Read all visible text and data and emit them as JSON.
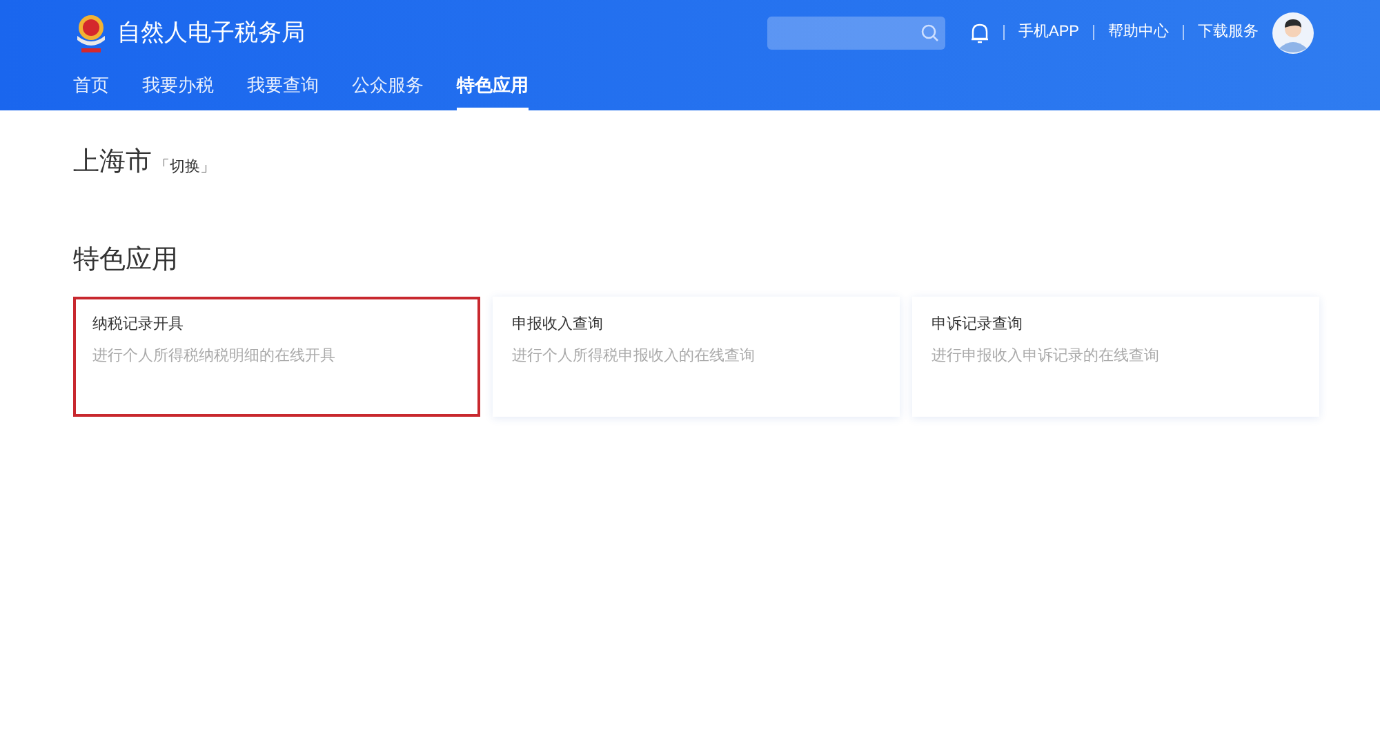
{
  "header": {
    "site_title": "自然人电子税务局",
    "links": [
      "手机APP",
      "帮助中心",
      "下载服务"
    ]
  },
  "nav": [
    {
      "label": "首页",
      "selected": false
    },
    {
      "label": "我要办税",
      "selected": false
    },
    {
      "label": "我要查询",
      "selected": false
    },
    {
      "label": "公众服务",
      "selected": false
    },
    {
      "label": "特色应用",
      "selected": true
    }
  ],
  "region": {
    "city": "上海市",
    "switch": "「切换」"
  },
  "section_title": "特色应用",
  "cards": [
    {
      "title": "纳税记录开具",
      "description": "进行个人所得税纳税明细的在线开具",
      "highlighted": true
    },
    {
      "title": "申报收入查询",
      "description": "进行个人所得税申报收入的在线查询",
      "highlighted": false
    },
    {
      "title": "申诉记录查询",
      "description": "进行申报收入申诉记录的在线查询",
      "highlighted": false
    }
  ]
}
